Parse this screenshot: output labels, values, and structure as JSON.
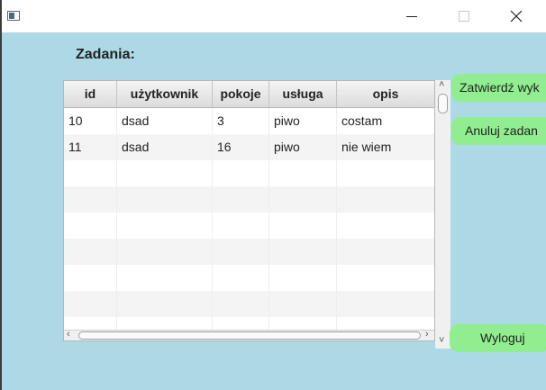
{
  "window": {
    "title_icon": "app-window-icon"
  },
  "titlebar": {
    "controls": [
      "minimize-icon",
      "maximize-icon",
      "close-icon"
    ]
  },
  "heading": "Zadania:",
  "table": {
    "columns": [
      "id",
      "użytkownik",
      "pokoje",
      "usługa",
      "opis"
    ],
    "rows": [
      [
        "10",
        "dsad",
        "3",
        "piwo",
        "costam"
      ],
      [
        "11",
        "dsad",
        "16",
        "piwo",
        "nie wiem"
      ],
      [
        "",
        "",
        "",
        "",
        ""
      ],
      [
        "",
        "",
        "",
        "",
        ""
      ],
      [
        "",
        "",
        "",
        "",
        ""
      ],
      [
        "",
        "",
        "",
        "",
        ""
      ],
      [
        "",
        "",
        "",
        "",
        ""
      ],
      [
        "",
        "",
        "",
        "",
        ""
      ],
      [
        "",
        "",
        "",
        "",
        ""
      ]
    ]
  },
  "buttons": {
    "confirm": "Zatwierdź wyk",
    "cancel": "Anuluj zadan",
    "logout": "Wyloguj"
  },
  "colors": {
    "background": "#add8e6",
    "button": "#90ee90",
    "titlebar": "#ffffff"
  }
}
